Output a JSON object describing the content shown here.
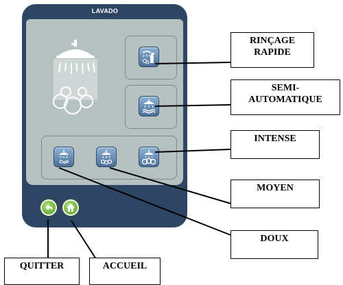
{
  "window": {
    "title": "LAVADO"
  },
  "buttons": {
    "rincage": {
      "icon": "spray-bottle-icon"
    },
    "semi": {
      "icon": "shower-water-icon"
    },
    "doux": {
      "icon": "shower-soft-icon"
    },
    "moyen": {
      "icon": "shower-medium-icon"
    },
    "intense": {
      "icon": "shower-intense-icon"
    },
    "quitter": {
      "icon": "back-arrow-icon"
    },
    "accueil": {
      "icon": "home-icon"
    }
  },
  "callouts": {
    "rincage": {
      "line1": "RINÇAGE",
      "line2": "RAPIDE"
    },
    "semi": {
      "line1": "SEMI-",
      "line2": "AUTOMATIQUE"
    },
    "intense": "INTENSE",
    "moyen": "MOYEN",
    "doux": "DOUX",
    "quitter": "QUITTER",
    "accueil": "ACCUEIL"
  },
  "colors": {
    "frame": "#2e4663",
    "screen": "#b5c0c0",
    "button_green": "#4c9a1e"
  }
}
